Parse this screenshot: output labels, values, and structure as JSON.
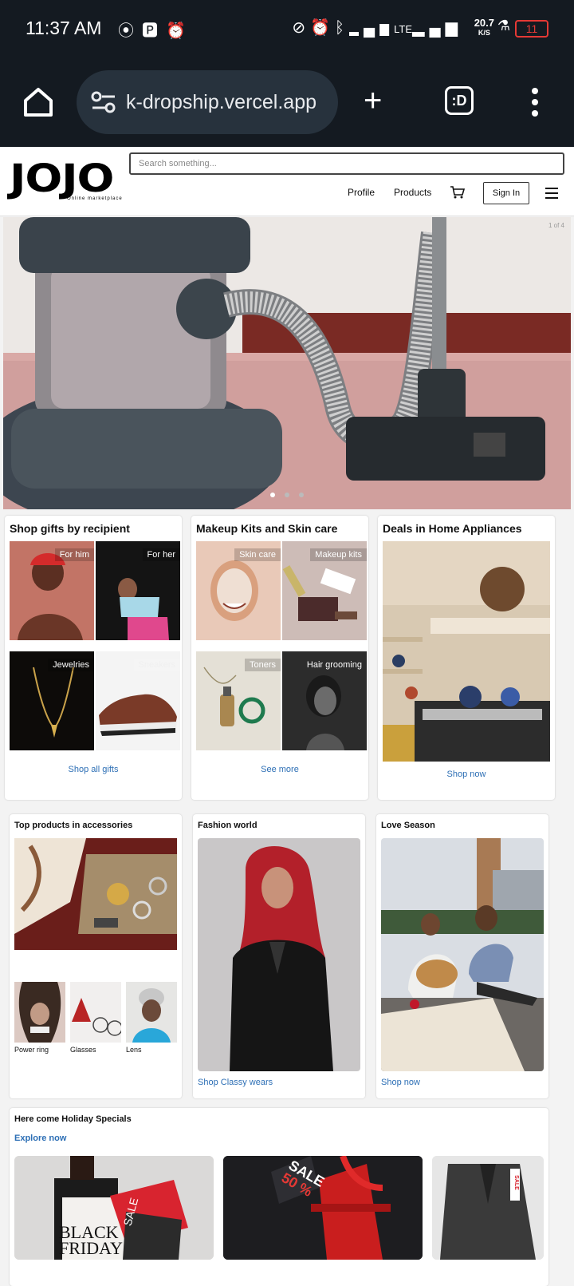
{
  "status_bar": {
    "time": "11:37 AM",
    "network": "LTE",
    "speed_top": "20.7",
    "speed_unit": "K/S",
    "battery": "11"
  },
  "browser": {
    "url": "k-dropship.vercel.app"
  },
  "site": {
    "logo_text": "JOJO",
    "logo_tagline": "Online marketplace",
    "search_placeholder": "Search something...",
    "nav": {
      "profile": "Profile",
      "products": "Products",
      "sign_in": "Sign In"
    },
    "hero": {
      "counter": "1 of 4",
      "slides": 3,
      "active": 0
    }
  },
  "sections": {
    "gifts": {
      "title": "Shop gifts by recipient",
      "tiles": [
        "For him",
        "For her",
        "Jewelries",
        "Sneakers"
      ],
      "link": "Shop all gifts"
    },
    "makeup": {
      "title": "Makeup Kits and Skin care",
      "tiles": [
        "Skin care",
        "Makeup kits",
        "Toners",
        "Hair grooming"
      ],
      "link": "See more"
    },
    "appliances": {
      "title": "Deals in Home Appliances",
      "link": "Shop now"
    },
    "accessories": {
      "title": "Top products in accessories",
      "items": [
        "Power ring",
        "Glasses",
        "Lens"
      ]
    },
    "fashion": {
      "title": "Fashion world",
      "link": "Shop Classy wears"
    },
    "love": {
      "title": "Love Season",
      "link": "Shop now"
    },
    "holiday": {
      "title": "Here come Holiday Specials",
      "link": "Explore now",
      "tile1_text_a": "BLACK",
      "tile1_text_b": "FRIDAY",
      "tile1_tag": "SALE",
      "tile2_tag": "SALE",
      "tile2_percent": "50 %",
      "tile3_tag": "SALE"
    }
  },
  "colors": {
    "browser_chrome": "#141a21",
    "link_blue": "#2d6fb5",
    "battery_low": "#e53935"
  }
}
